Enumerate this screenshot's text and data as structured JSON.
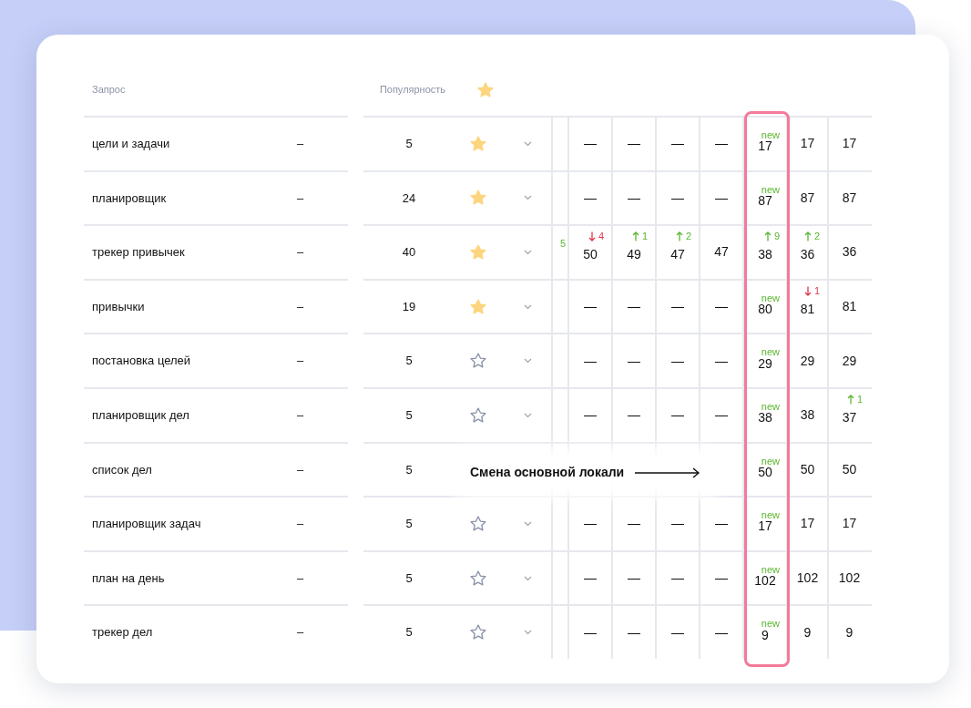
{
  "table": {
    "columns": {
      "query": "Запрос",
      "popularity": "Популярность"
    },
    "rows": [
      {
        "query": "цели и задачи",
        "col2": "–",
        "popularity": "5",
        "starred": true,
        "cells": [
          {
            "value": "—"
          },
          {
            "value": "—"
          },
          {
            "value": "—"
          },
          {
            "value": "—"
          },
          {
            "value": "17",
            "note": "new",
            "kind": "new"
          },
          {
            "value": "17"
          },
          {
            "value": "17"
          }
        ]
      },
      {
        "query": "планировщик",
        "col2": "–",
        "popularity": "24",
        "starred": true,
        "cells": [
          {
            "value": "—"
          },
          {
            "value": "—"
          },
          {
            "value": "—"
          },
          {
            "value": "—"
          },
          {
            "value": "87",
            "note": "new",
            "kind": "new"
          },
          {
            "value": "87"
          },
          {
            "value": "87"
          }
        ]
      },
      {
        "query": "трекер привычек",
        "col2": "–",
        "popularity": "40",
        "starred": true,
        "edge_note": {
          "text": "5",
          "kind": "up"
        },
        "cells": [
          {
            "value": "50",
            "note": "4",
            "kind": "down"
          },
          {
            "value": "49",
            "note": "1",
            "kind": "up"
          },
          {
            "value": "47",
            "note": "2",
            "kind": "up"
          },
          {
            "value": "47"
          },
          {
            "value": "38",
            "note": "9",
            "kind": "up"
          },
          {
            "value": "36",
            "note": "2",
            "kind": "up"
          },
          {
            "value": "36"
          }
        ]
      },
      {
        "query": "привычки",
        "col2": "–",
        "popularity": "19",
        "starred": true,
        "cells": [
          {
            "value": "—"
          },
          {
            "value": "—"
          },
          {
            "value": "—"
          },
          {
            "value": "—"
          },
          {
            "value": "80",
            "note": "new",
            "kind": "new"
          },
          {
            "value": "81",
            "note": "1",
            "kind": "down"
          },
          {
            "value": "81"
          }
        ]
      },
      {
        "query": "постановка целей",
        "col2": "–",
        "popularity": "5",
        "starred": false,
        "cells": [
          {
            "value": "—"
          },
          {
            "value": "—"
          },
          {
            "value": "—"
          },
          {
            "value": "—"
          },
          {
            "value": "29",
            "note": "new",
            "kind": "new"
          },
          {
            "value": "29"
          },
          {
            "value": "29"
          }
        ]
      },
      {
        "query": "планировщик дел",
        "col2": "–",
        "popularity": "5",
        "starred": false,
        "cells": [
          {
            "value": "—"
          },
          {
            "value": "—"
          },
          {
            "value": "—"
          },
          {
            "value": "—"
          },
          {
            "value": "38",
            "note": "new",
            "kind": "new"
          },
          {
            "value": "38"
          },
          {
            "value": "37",
            "note": "1",
            "kind": "up"
          }
        ]
      },
      {
        "query": "список дел",
        "col2": "–",
        "popularity": "5",
        "cells": [
          {},
          {},
          {},
          {},
          {
            "value": "50",
            "note": "new",
            "kind": "new"
          },
          {
            "value": "50"
          },
          {
            "value": "50"
          }
        ]
      },
      {
        "query": "планировщик задач",
        "col2": "–",
        "popularity": "5",
        "starred": false,
        "cells": [
          {
            "value": "—"
          },
          {
            "value": "—"
          },
          {
            "value": "—"
          },
          {
            "value": "—"
          },
          {
            "value": "17",
            "note": "new",
            "kind": "new"
          },
          {
            "value": "17"
          },
          {
            "value": "17"
          }
        ]
      },
      {
        "query": "план на день",
        "col2": "–",
        "popularity": "5",
        "starred": false,
        "cells": [
          {
            "value": "—"
          },
          {
            "value": "—"
          },
          {
            "value": "—"
          },
          {
            "value": "—"
          },
          {
            "value": "102",
            "note": "new",
            "kind": "new"
          },
          {
            "value": "102"
          },
          {
            "value": "102"
          }
        ]
      },
      {
        "query": "трекер дел",
        "col2": "–",
        "popularity": "5",
        "starred": false,
        "cells": [
          {
            "value": "—"
          },
          {
            "value": "—"
          },
          {
            "value": "—"
          },
          {
            "value": "—"
          },
          {
            "value": "9",
            "note": "new",
            "kind": "new"
          },
          {
            "value": "9"
          },
          {
            "value": "9"
          }
        ]
      }
    ]
  },
  "annotation": {
    "text": "Смена основной локали"
  }
}
